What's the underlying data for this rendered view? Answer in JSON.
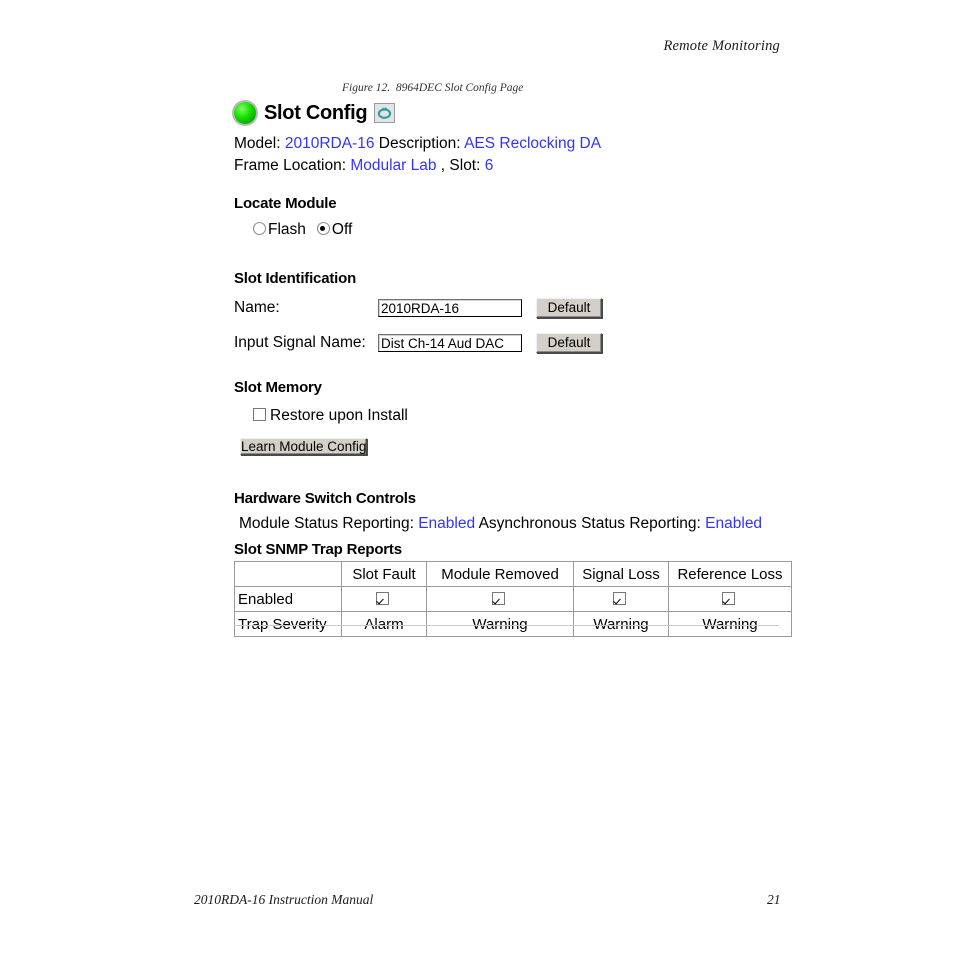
{
  "document": {
    "running_header": "Remote Monitoring",
    "figure_caption": "Figure 12.  8964DEC Slot Config Page",
    "footer_left": "2010RDA-16 Instruction Manual",
    "footer_page_number": "21"
  },
  "webui": {
    "title": "Slot Config",
    "status_led_color": "#18e000",
    "refresh_icon_color": "#2f9d9d",
    "link_color": "#3333ff",
    "info": {
      "model_label": "Model:",
      "model_value": "2010RDA-16",
      "description_label": "Description:",
      "description_value": "AES Reclocking DA",
      "frame_location_label": "Frame Location:",
      "frame_location_value": "Modular Lab",
      "slot_label": ", Slot:",
      "slot_value": "6"
    },
    "locate_module": {
      "heading": "Locate Module",
      "options": [
        {
          "label": "Flash",
          "selected": false
        },
        {
          "label": "Off",
          "selected": true
        }
      ]
    },
    "slot_identification": {
      "heading": "Slot Identification",
      "name_label": "Name:",
      "name_value": "2010RDA-16",
      "name_default_button": "Default",
      "input_signal_label": "Input Signal Name:",
      "input_signal_value": "Dist Ch-14 Aud DAC",
      "input_signal_default_button": "Default"
    },
    "slot_memory": {
      "heading": "Slot Memory",
      "restore_label": "Restore upon Install",
      "restore_checked": false,
      "learn_button": "Learn Module Config"
    },
    "hardware_switch_controls": {
      "heading": "Hardware Switch Controls",
      "module_status_label": "Module Status Reporting:",
      "module_status_value": "Enabled",
      "async_status_label": "Asynchronous Status Reporting:",
      "async_status_value": "Enabled"
    },
    "trap_reports": {
      "heading": "Slot SNMP Trap Reports",
      "columns": [
        "Slot Fault",
        "Module Removed",
        "Signal Loss",
        "Reference Loss"
      ],
      "rows": [
        {
          "label": "Enabled",
          "values": [
            true,
            true,
            true,
            true
          ]
        },
        {
          "label": "Trap Severity",
          "values": [
            "Alarm",
            "Warning",
            "Warning",
            "Warning"
          ]
        }
      ]
    }
  }
}
